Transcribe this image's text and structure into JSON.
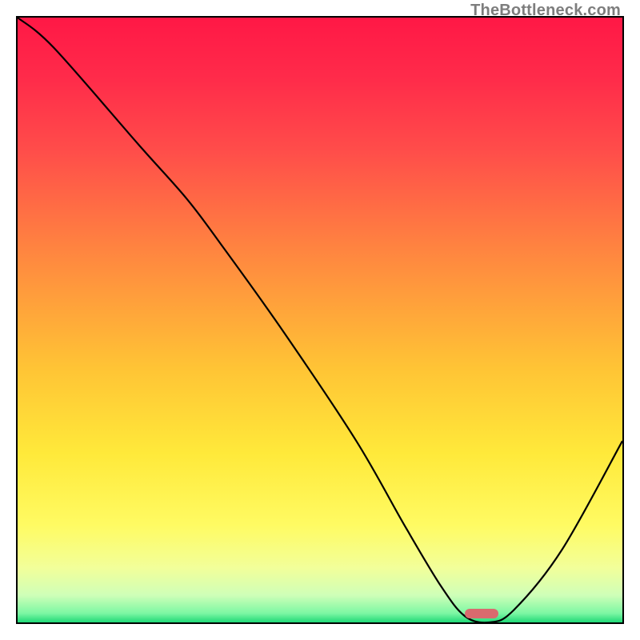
{
  "watermark": "TheBottleneck.com",
  "colors": {
    "gradient_stops": [
      {
        "offset": 0.0,
        "color": "#ff1846"
      },
      {
        "offset": 0.1,
        "color": "#ff2b4a"
      },
      {
        "offset": 0.22,
        "color": "#ff4d4a"
      },
      {
        "offset": 0.4,
        "color": "#ff8a3f"
      },
      {
        "offset": 0.58,
        "color": "#ffc435"
      },
      {
        "offset": 0.72,
        "color": "#ffe93a"
      },
      {
        "offset": 0.84,
        "color": "#fffb63"
      },
      {
        "offset": 0.91,
        "color": "#f2ff9a"
      },
      {
        "offset": 0.955,
        "color": "#cfffb8"
      },
      {
        "offset": 0.985,
        "color": "#7cf7a3"
      },
      {
        "offset": 1.0,
        "color": "#1fd877"
      }
    ],
    "curve_stroke": "#000000",
    "marker_fill": "#d96a6e",
    "frame_stroke": "#000000"
  },
  "chart_data": {
    "type": "line",
    "title": "",
    "xlabel": "",
    "ylabel": "",
    "xlim": [
      0,
      100
    ],
    "ylim": [
      0,
      100
    ],
    "grid": false,
    "legend": false,
    "series": [
      {
        "name": "bottleneck-curve",
        "x": [
          0,
          6,
          20,
          28,
          34,
          44,
          56,
          64,
          70,
          74,
          78,
          82,
          90,
          100
        ],
        "y": [
          100,
          95,
          79,
          70,
          62,
          48,
          30,
          16,
          6,
          1,
          0,
          2,
          12,
          30
        ]
      }
    ],
    "marker": {
      "name": "optimal-range",
      "x_start": 74,
      "x_end": 79.5,
      "y": 0.6,
      "height": 1.6
    }
  }
}
